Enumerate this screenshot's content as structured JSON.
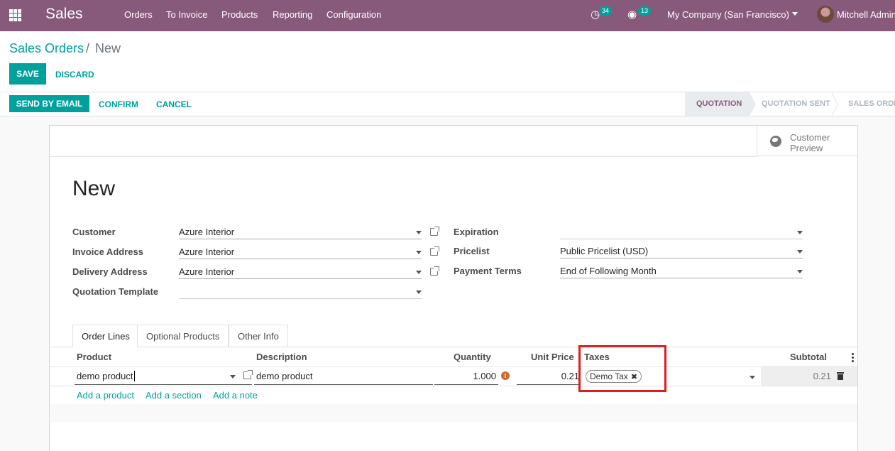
{
  "navbar": {
    "app_name": "Sales",
    "menu": [
      "Orders",
      "To Invoice",
      "Products",
      "Reporting",
      "Configuration"
    ],
    "activity_badge": "34",
    "messages_badge": "13",
    "company": "My Company (San Francisco)",
    "user": "Mitchell Admin"
  },
  "breadcrumb": {
    "parent": "Sales Orders",
    "separator": "/",
    "current": "New"
  },
  "buttons": {
    "save": "SAVE",
    "discard": "DISCARD",
    "send_by_email": "SEND BY EMAIL",
    "confirm": "CONFIRM",
    "cancel": "CANCEL"
  },
  "statusbar": [
    "QUOTATION",
    "QUOTATION SENT",
    "SALES ORDER"
  ],
  "customer_preview": "Customer Preview",
  "record_title": "New",
  "left_fields": [
    {
      "label": "Customer",
      "value": "Azure Interior"
    },
    {
      "label": "Invoice Address",
      "value": "Azure Interior"
    },
    {
      "label": "Delivery Address",
      "value": "Azure Interior"
    },
    {
      "label": "Quotation Template",
      "value": ""
    }
  ],
  "right_fields": [
    {
      "label": "Expiration",
      "value": ""
    },
    {
      "label": "Pricelist",
      "value": "Public Pricelist (USD)"
    },
    {
      "label": "Payment Terms",
      "value": "End of Following Month"
    }
  ],
  "tabs": [
    "Order Lines",
    "Optional Products",
    "Other Info"
  ],
  "table": {
    "headers": {
      "product": "Product",
      "description": "Description",
      "quantity": "Quantity",
      "unit_price": "Unit Price",
      "taxes": "Taxes",
      "subtotal": "Subtotal"
    },
    "row": {
      "product": "demo product",
      "description": "demo product",
      "quantity": "1.000",
      "unit_price": "0.21",
      "tax_tag": "Demo Tax",
      "subtotal": "0.21"
    },
    "add_links": [
      "Add a product",
      "Add a section",
      "Add a note"
    ]
  },
  "colors": {
    "brand": "#875a7b",
    "accent": "#00a09d",
    "highlight": "#e21b1b"
  }
}
